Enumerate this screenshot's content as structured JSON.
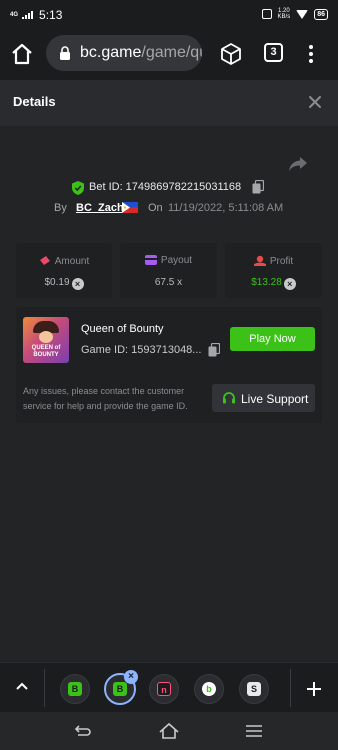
{
  "status_bar": {
    "network": "4G",
    "time": "5:13",
    "speed_value": "1.20",
    "speed_unit": "KB/s",
    "battery": "86"
  },
  "browser": {
    "url_domain": "bc.game",
    "url_path": "/game/qu",
    "tab_count": "3"
  },
  "details": {
    "title": "Details",
    "bet_id": "Bet ID: 1749869782215031168",
    "by_label": "By",
    "username": "BC_Zachi",
    "on_label": "On",
    "datetime": "11/19/2022, 5:11:08 AM"
  },
  "stats": {
    "amount": {
      "label": "Amount",
      "value": "$0.19"
    },
    "payout": {
      "label": "Payout",
      "value": "67.5 x"
    },
    "profit": {
      "label": "Profit",
      "value": "$13.28"
    }
  },
  "game": {
    "name": "Queen of Bounty",
    "game_id": "Game ID: 1593713048...",
    "thumbnail_text": "QUEEN of BOUNTY",
    "play_label": "Play Now",
    "support_note": "Any issues, please contact the customer service for help and provide the game ID.",
    "support_label": "Live Support"
  },
  "colors": {
    "accent_green": "#3bc117",
    "background": "#232426",
    "tab_highlight": "#8fb4ff"
  },
  "icons": [
    "home-icon",
    "lock-icon",
    "cube-icon",
    "tab-switcher-icon",
    "more-vert-icon",
    "close-icon",
    "share-icon",
    "shield-icon",
    "copy-icon",
    "flag-icon",
    "amount-icon",
    "payout-icon",
    "profit-icon",
    "headset-icon",
    "chevron-up-icon",
    "plus-icon",
    "nav-back-icon",
    "nav-home-icon",
    "nav-menu-icon"
  ]
}
